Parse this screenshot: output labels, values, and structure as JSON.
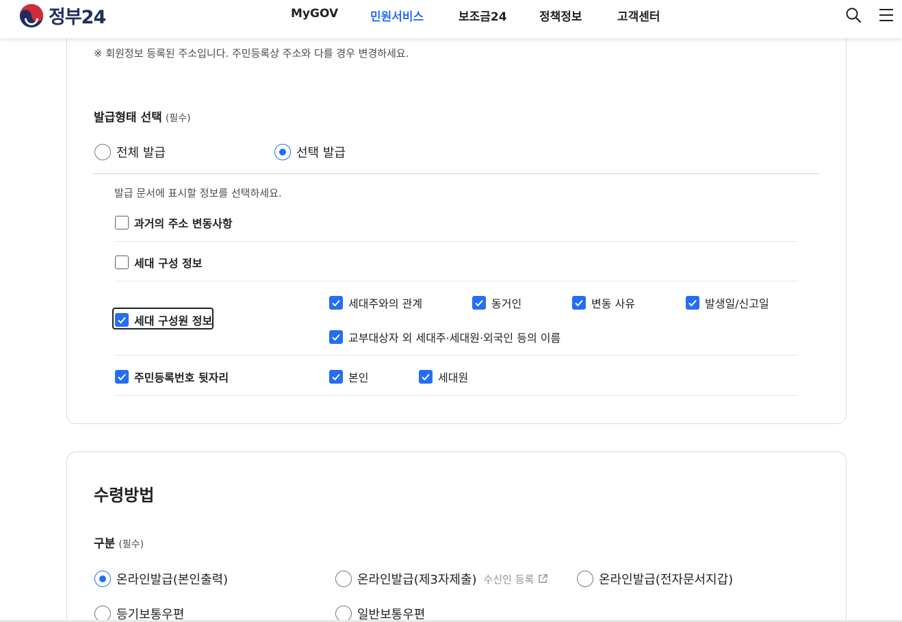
{
  "header": {
    "logo_text": "정부24",
    "nav": [
      {
        "label": "MyGOV",
        "active": false
      },
      {
        "label": "민원서비스",
        "active": true
      },
      {
        "label": "보조금24",
        "active": false
      },
      {
        "label": "정책정보",
        "active": false
      },
      {
        "label": "고객센터",
        "active": false
      }
    ],
    "icons": [
      "search-icon",
      "menu-icon"
    ]
  },
  "colors": {
    "accent": "#256ef4",
    "brand_navy": "#1f2f5f",
    "brand_red": "#cd2e3a"
  },
  "issuance": {
    "notice": "※ 회원정보 등록된 주소입니다. 주민등록상 주소와 다를 경우 변경하세요.",
    "title": "발급형태 선택",
    "required": "(필수)",
    "options": [
      {
        "label": "전체 발급",
        "selected": false
      },
      {
        "label": "선택 발급",
        "selected": true
      }
    ],
    "hint": "발급 문서에 표시할 정보를 선택하세요.",
    "items": {
      "past_address": {
        "label": "과거의 주소 변동사항",
        "checked": false
      },
      "household_info": {
        "label": "세대 구성 정보",
        "checked": false
      },
      "household_member": {
        "label": "세대 구성원 정보",
        "checked": true,
        "sub": [
          {
            "label": "세대주와의 관계",
            "checked": true
          },
          {
            "label": "동거인",
            "checked": true
          },
          {
            "label": "변동 사유",
            "checked": true
          },
          {
            "label": "발생일/신고일",
            "checked": true
          },
          {
            "label": "교부대상자 외 세대주·세대원·외국인 등의 이름",
            "checked": true
          }
        ]
      },
      "rrn_suffix": {
        "label": "주민등록번호 뒷자리",
        "checked": true,
        "sub": [
          {
            "label": "본인",
            "checked": true
          },
          {
            "label": "세대원",
            "checked": true
          }
        ]
      }
    }
  },
  "receipt": {
    "title": "수령방법",
    "category_label": "구분",
    "required": "(필수)",
    "options": [
      {
        "label": "온라인발급(본인출력)",
        "selected": true
      },
      {
        "label": "온라인발급(제3자제출)",
        "selected": false,
        "link": "수신인 등록"
      },
      {
        "label": "온라인발급(전자문서지갑)",
        "selected": false
      },
      {
        "label": "등기보통우편",
        "selected": false
      },
      {
        "label": "일반보통우편",
        "selected": false
      }
    ]
  }
}
